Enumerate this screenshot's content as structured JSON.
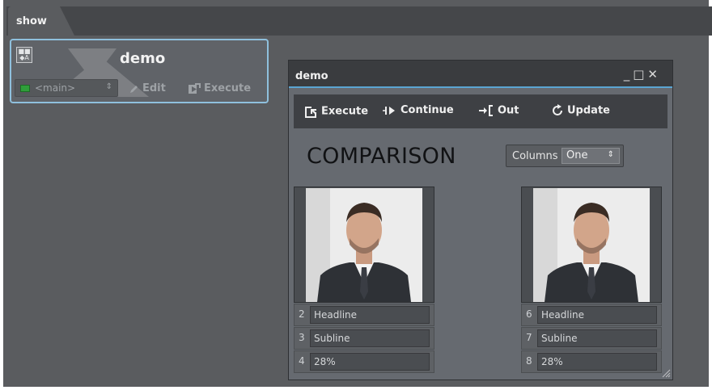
{
  "tabs": [
    {
      "label": "show"
    }
  ],
  "macro_card": {
    "title": "demo",
    "channel_select": "<main>",
    "edit_label": "Edit",
    "execute_label": "Execute"
  },
  "window": {
    "title": "demo",
    "toolbar": {
      "execute": "Execute",
      "continue": "Continue",
      "out": "Out",
      "update": "Update"
    },
    "heading": "COMPARISON",
    "columns": {
      "label": "Columns",
      "value": "One"
    },
    "panels": [
      {
        "fields": [
          {
            "num": "2",
            "value": "Headline"
          },
          {
            "num": "3",
            "value": "Subline"
          },
          {
            "num": "4",
            "value": "28%"
          }
        ]
      },
      {
        "fields": [
          {
            "num": "6",
            "value": "Headline"
          },
          {
            "num": "7",
            "value": "Subline"
          },
          {
            "num": "8",
            "value": "28%"
          }
        ]
      }
    ]
  },
  "colors": {
    "accent": "#5aa5d3",
    "card_border": "#8fc0dd",
    "channel_icon": "#2f9e3a"
  }
}
